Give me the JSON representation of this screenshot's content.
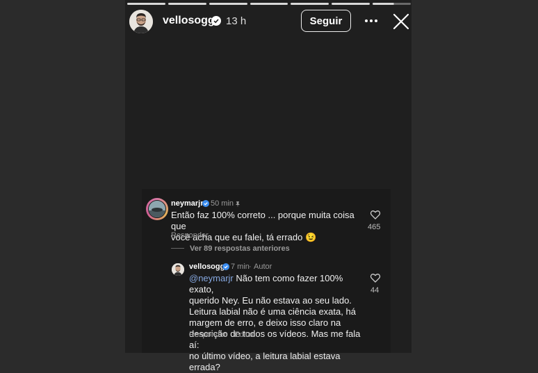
{
  "story": {
    "username": "vellosogg",
    "time": "13 h",
    "follow_label": "Seguir"
  },
  "comment1": {
    "username": "neymarjr",
    "time": "50 min",
    "text": "Então faz 100% correto ... porque muita coisa que\nvocê acha que eu falei, tá errado 😉",
    "reply_label": "Responder",
    "likes": "465"
  },
  "view_replies": "Ver 89 respostas anteriores",
  "comment2": {
    "username": "vellosogg",
    "time": "7 min",
    "author_tag": "Autor",
    "mention": "@neymarjr",
    "text": " Não tem como fazer 100% exato,\nquerido Ney. Eu não estava ao seu lado.\nLeitura labial não é uma ciência exata, há\nmargem de erro, e deixo isso claro na\ndescrição de todos os vídeos. Mas me fala aí:\nno último vídeo, a leitura labial estava errada?",
    "reply_label": "Responder",
    "edit_label": "Editar",
    "likes": "44"
  }
}
